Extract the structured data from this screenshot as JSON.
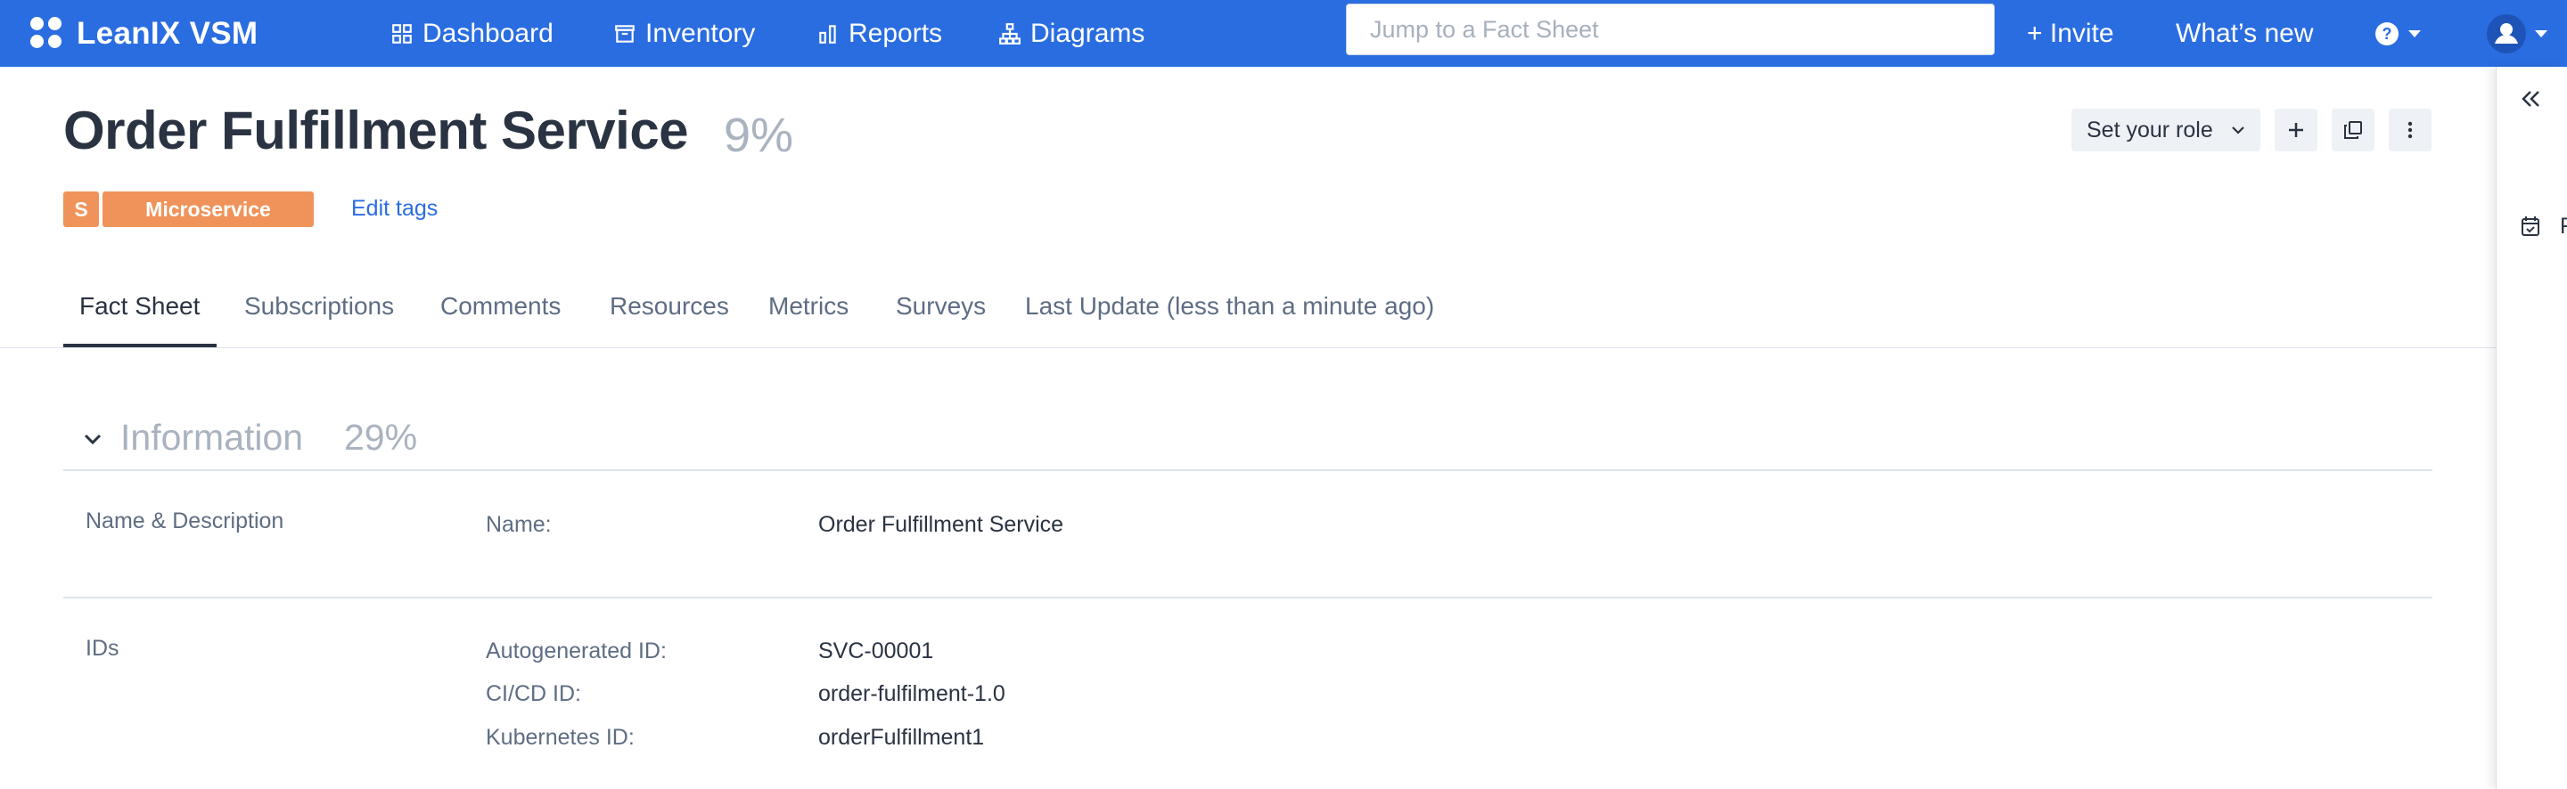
{
  "app": {
    "name": "LeanIX VSM"
  },
  "nav": {
    "dashboard": "Dashboard",
    "inventory": "Inventory",
    "reports": "Reports",
    "diagrams": "Diagrams"
  },
  "search": {
    "placeholder": "Jump to a Fact Sheet"
  },
  "topbar": {
    "invite": "+ Invite",
    "whats_new": "What’s new",
    "help_icon": "question-circle-icon",
    "user_icon": "user-avatar-icon"
  },
  "factsheet": {
    "title": "Order Fulfillment Service",
    "completion": "9%",
    "tag_letter": "S",
    "tag_type": "Microservice",
    "edit_tags": "Edit tags",
    "tag_color": "#f0935a"
  },
  "actions": {
    "role": "Set your role"
  },
  "tabs": [
    {
      "label": "Fact Sheet",
      "active": true
    },
    {
      "label": "Subscriptions"
    },
    {
      "label": "Comments"
    },
    {
      "label": "Resources"
    },
    {
      "label": "Metrics"
    },
    {
      "label": "Surveys"
    },
    {
      "label": "Last Update (less than a minute ago)"
    }
  ],
  "information": {
    "title": "Information",
    "completion": "29%",
    "name_section": {
      "label": "Name & Description",
      "name_label": "Name:",
      "name_value": "Order Fulfillment Service"
    },
    "ids_section": {
      "label": "IDs",
      "fields": [
        {
          "label": "Autogenerated ID:",
          "value": "SVC-00001"
        },
        {
          "label": "CI/CD ID:",
          "value": "order-fulfilment-1.0"
        },
        {
          "label": "Kubernetes ID:",
          "value": "orderFulfillment1"
        }
      ]
    }
  },
  "side_panel": {
    "partial_label": "F"
  },
  "colors": {
    "accent": "#2a6de1",
    "text": "#2a3342",
    "muted": "#a9b2bf"
  }
}
